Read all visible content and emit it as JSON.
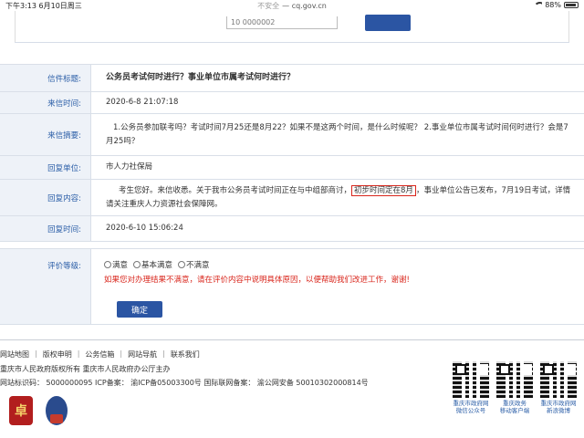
{
  "status_bar": {
    "time": "下午3:13",
    "date": "6月10日周三",
    "insecure_label": "不安全",
    "url": "cq.gov.cn",
    "battery_text": "88%",
    "battery_level": 0.88
  },
  "top_form": {
    "partial_field_text": "10 0000002"
  },
  "letter": {
    "title_label": "信件标题:",
    "title": "公务员考试何时进行？事业单位市属考试何时进行？",
    "received_label": "来信时间:",
    "received_time": "2020-6-8 21:07:18",
    "summary_label": "来信摘要:",
    "summary_line1": "1.公务员参加联考吗？考试时间7月25还是8月22？如果不是这两个时间，是什么时候呢？ 2.事业单位市属考试时间何时进行？会是7",
    "summary_line2": "月25吗？",
    "reply_unit_label": "回复单位:",
    "reply_unit": "市人力社保局",
    "reply_content_label": "回复内容:",
    "reply_part1": "考生您好。来信收悉。关于我市公务员考试时间正在与中组部商讨，",
    "reply_highlight": "初步时间定在8月",
    "reply_part2": "，事业单位公告已发布，7月19日考试，详情",
    "reply_line2": "请关注重庆人力资源社会保障网。",
    "reply_time_label": "回复时间:",
    "reply_time": "2020-6-10 15:06:24"
  },
  "rating": {
    "label": "评价等级:",
    "options": [
      "满意",
      "基本满意",
      "不满意"
    ],
    "note": "如果您对办理结果不满意，请在评价内容中说明具体原因，以便帮助我们改进工作，谢谢!",
    "confirm_label": "确定"
  },
  "footer": {
    "links": [
      "网站地图",
      "版权申明",
      "公务信箱",
      "网站导航",
      "联系我们"
    ],
    "line1": "重庆市人民政府版权所有  重庆市人民政府办公厅主办",
    "line2": "网站标识码：  5000000095     ICP备案：  渝ICP备05003300号     国际联网备案：  渝公网安备 50010302000814号",
    "badge1_char": "卓",
    "qr_codes": [
      {
        "label_line1": "重庆市政府网",
        "label_line2": "微信公众号"
      },
      {
        "label_line1": "重庆政务",
        "label_line2": "移动客户端"
      },
      {
        "label_line1": "重庆市政府网",
        "label_line2": "新浪微博"
      }
    ]
  },
  "colors": {
    "label_blue": "#2b5ea7",
    "label_bg": "#eef2f8",
    "button_blue": "#2b55a3",
    "highlight_red": "#d9261c"
  }
}
